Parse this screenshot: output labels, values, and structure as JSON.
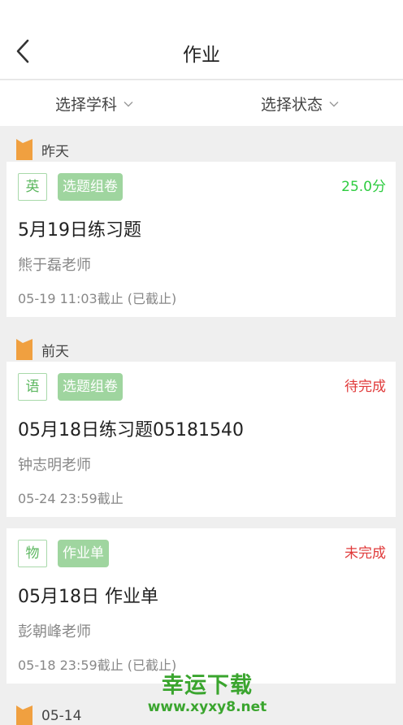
{
  "header": {
    "title": "作业"
  },
  "filters": {
    "subject_label": "选择学科",
    "status_label": "选择状态"
  },
  "groups": [
    {
      "label": "昨天"
    },
    {
      "label": "前天"
    },
    {
      "label": "05-14"
    }
  ],
  "cards": [
    {
      "subject": "英",
      "tag": "选题组卷",
      "status": "25.0分",
      "status_color": "#2ecc40",
      "title": "5月19日练习题",
      "teacher": "熊于磊老师",
      "deadline": "05-19 11:03截止 (已截止)"
    },
    {
      "subject": "语",
      "tag": "选题组卷",
      "status": "待完成",
      "status_color": "#e03a3a",
      "title": "05月18日练习题05181540",
      "teacher": "钟志明老师",
      "deadline": "05-24 23:59截止"
    },
    {
      "subject": "物",
      "tag": "作业单",
      "status": "未完成",
      "status_color": "#e03a3a",
      "title": "05月18日 作业单",
      "teacher": "彭朝峰老师",
      "deadline": "05-18 23:59截止 (已截止)"
    }
  ],
  "watermark": {
    "line1": "幸运下载",
    "line2": "www.xyxy8.net"
  },
  "colors": {
    "flag": "#f0a040",
    "accent_green": "#5db760",
    "tag_bg": "#9fd59f"
  }
}
